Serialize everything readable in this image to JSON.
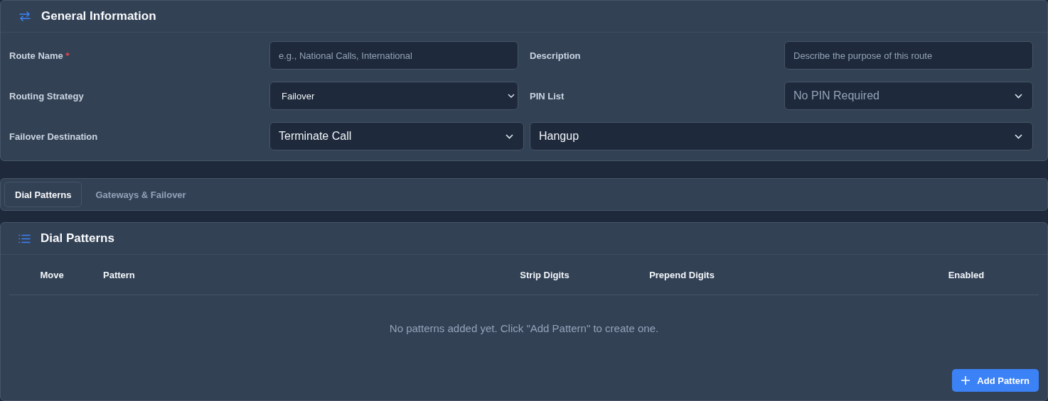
{
  "general": {
    "title": "General Information",
    "route_name": {
      "label": "Route Name",
      "required_mark": "*",
      "placeholder": "e.g., National Calls, International"
    },
    "description": {
      "label": "Description",
      "placeholder": "Describe the purpose of this route"
    },
    "routing_strategy": {
      "label": "Routing Strategy",
      "value": "Failover"
    },
    "pin_list": {
      "label": "PIN List",
      "value": "No PIN Required"
    },
    "failover_destination": {
      "label": "Failover Destination",
      "type_value": "Terminate Call",
      "target_value": "Hangup"
    }
  },
  "tabs": [
    {
      "label": "Dial Patterns",
      "selected": true
    },
    {
      "label": "Gateways & Failover",
      "selected": false
    }
  ],
  "dial_patterns": {
    "title": "Dial Patterns",
    "table": {
      "columns": [
        "Move",
        "Pattern",
        "Strip Digits",
        "Prepend Digits",
        "Enabled"
      ],
      "empty_message": "No patterns added yet. Click \"Add Pattern\" to create one."
    },
    "add_button": "Add Pattern"
  }
}
